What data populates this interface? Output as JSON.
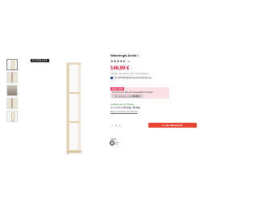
{
  "badge": {
    "label": "EXTRA 10%"
  },
  "thumbnails": [
    {
      "icon": "shelf-thumbnail-icon"
    },
    {
      "icon": "detail-thumbnail-icon"
    },
    {
      "icon": "room-thumbnail-icon"
    },
    {
      "icon": "detail-thumbnail-icon"
    },
    {
      "icon": "shelf-thumbnail-icon"
    }
  ],
  "product": {
    "title": "Wandregal Anelo I",
    "rating_stars": "★★★★★",
    "rating_count": "(1)",
    "price": "149,99 €",
    "price_info": "ⓘ",
    "subline": "149,99 € inkl. MwSt. zzgl. Versandkosten",
    "tag_text": "170 PROBATE-Bestseller/Anlieferung"
  },
  "promo": {
    "head": "Extra 10%",
    "text": "Nur für kurze Zeit auf ausgewählte Produkte",
    "code_prefix": "Mit Gutschein-Code ",
    "code": "WOHN10"
  },
  "stock": {
    "label": "Auslieferung in 5 Werkt.",
    "delivery_prefix": "Vor. Lieferung ",
    "delivery_dates": "21 Aug - 25 Aug",
    "more_link": "Mehr zu Versand und Lieferung"
  },
  "cart": {
    "qty_minus": "−",
    "qty_value": "1",
    "qty_plus": "+",
    "button_label": "In den Warenkorb"
  },
  "colors": {
    "label": "Farbe:",
    "swatches": [
      "#f4eee2",
      "#ffffff"
    ]
  }
}
